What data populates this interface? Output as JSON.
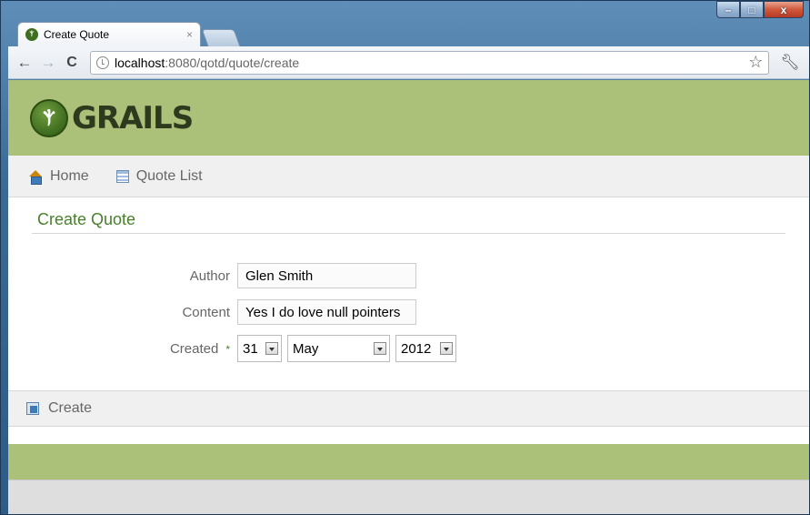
{
  "browser": {
    "tab": {
      "title": "Create Quote",
      "close_glyph": "×"
    },
    "window_controls": {
      "minimize": "–",
      "maximize": "□",
      "close": "x"
    },
    "address": {
      "host": "localhost",
      "path": ":8080/qotd/quote/create"
    }
  },
  "site": {
    "logo_text": "GRAILS",
    "nav": {
      "home": "Home",
      "list": "Quote List"
    }
  },
  "page": {
    "title": "Create Quote",
    "fields": {
      "author": {
        "label": "Author",
        "value": "Glen Smith"
      },
      "content": {
        "label": "Content",
        "value": "Yes I do love null pointers"
      },
      "created": {
        "label": "Created",
        "required_mark": "*",
        "day": "31",
        "month": "May",
        "year": "2012"
      }
    },
    "create_button": "Create"
  },
  "colors": {
    "header_green": "#abc179",
    "title_green": "#48802c"
  }
}
